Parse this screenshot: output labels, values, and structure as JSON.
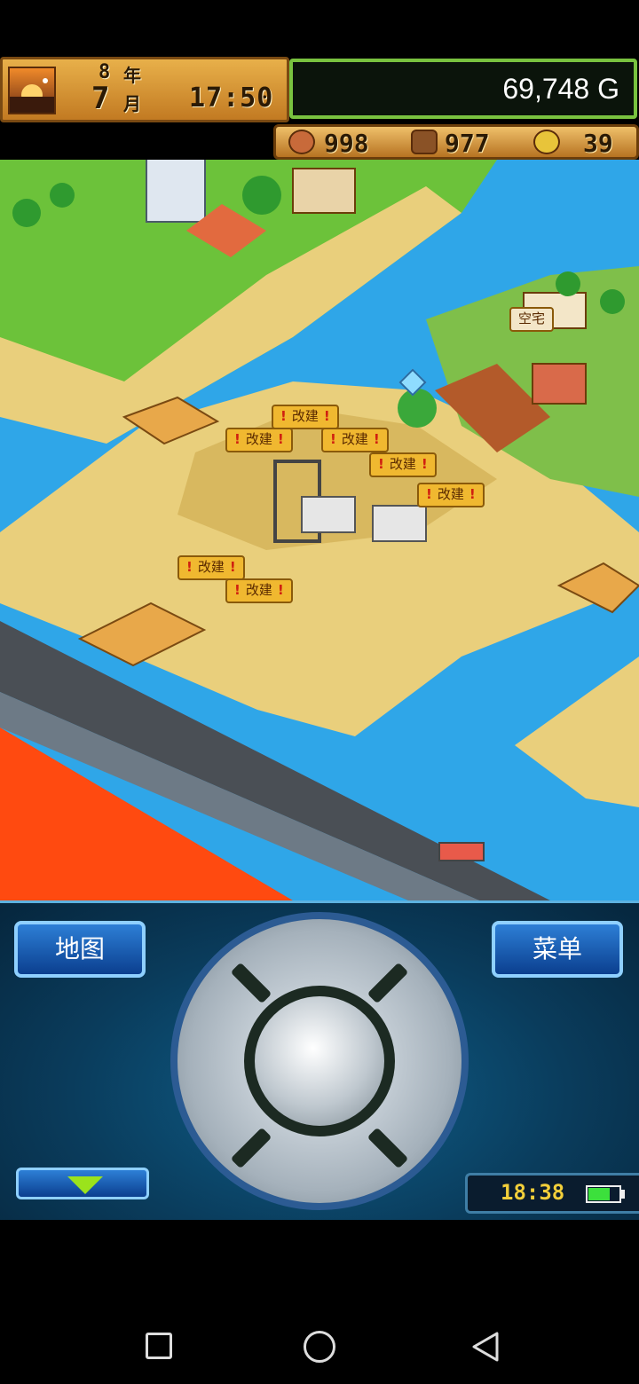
{
  "hud": {
    "year": "8",
    "year_label": "年",
    "month": "7",
    "month_label": "月",
    "time": "17:50",
    "money": "69,748 G",
    "resources": [
      {
        "icon": "meat-icon",
        "value": "998",
        "color": "#c86a3a"
      },
      {
        "icon": "wood-log-icon",
        "value": "977",
        "color": "#8a5226"
      },
      {
        "icon": "gold-coin-icon",
        "value": "39",
        "color": "#e8c43a"
      }
    ]
  },
  "map": {
    "vacant_lot_label": "空宅",
    "rebuild_signs": [
      "改建",
      "改建",
      "改建",
      "改建",
      "改建",
      "改建",
      "改建"
    ]
  },
  "controls": {
    "map_button": "地图",
    "menu_button": "菜单",
    "device_time": "18:38",
    "battery_level": 0.7
  },
  "colors": {
    "water": "#2fa6e8",
    "sand": "#e9cf7c",
    "grass": "#6cc23a",
    "panel": "#0a3c5c",
    "hud_gold": "#e8b04a",
    "money_border": "#79c23f"
  }
}
